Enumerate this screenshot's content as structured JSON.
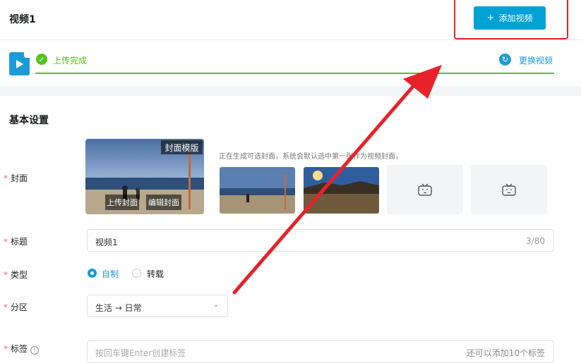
{
  "page": {
    "title": "视频1"
  },
  "header": {
    "add_video_label": "添加视频",
    "add_video_icon": "plus-icon"
  },
  "upload": {
    "status": "上传完成",
    "progress": 1.0,
    "replace_label": "更换视频"
  },
  "section": {
    "basic_settings": "基本设置"
  },
  "cover": {
    "label": "封面",
    "template_label": "封面模版",
    "upload_cover": "上传封面",
    "edit_cover": "编辑封面",
    "hint": "正在生成可选封面，系统会默认选中第一张作为视频封面，",
    "placeholder_icon": "tv-icon"
  },
  "title_field": {
    "label": "标题",
    "value": "视频1",
    "counter": "3/80"
  },
  "type_field": {
    "label": "类型",
    "options": [
      "自制",
      "转载"
    ],
    "selected": "自制"
  },
  "category_field": {
    "label": "分区",
    "value": "生活 → 日常"
  },
  "tags_field": {
    "label": "标签",
    "placeholder": "按回车键Enter创建标签",
    "hint": "还可以添加10个标签"
  },
  "colors": {
    "accent": "#00a1d6",
    "success": "#52c41a",
    "annotation": "#e8222a"
  }
}
